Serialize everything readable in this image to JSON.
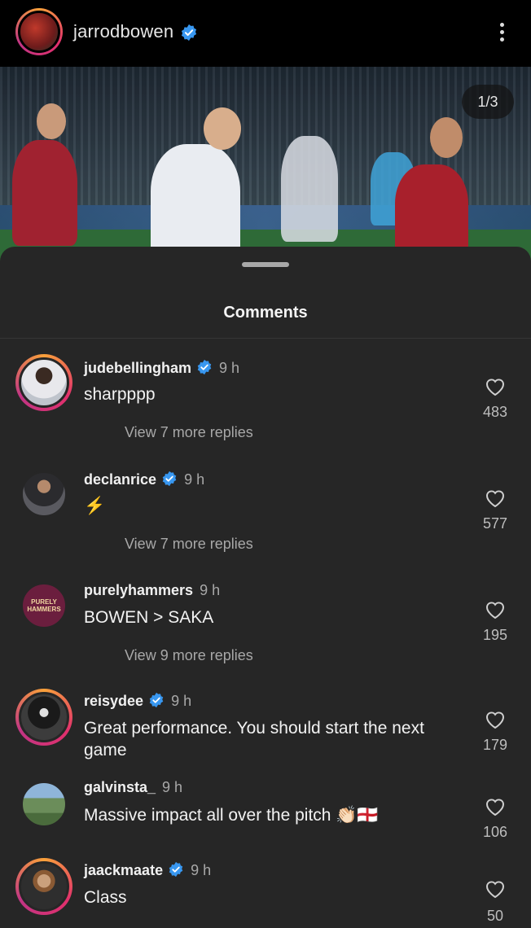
{
  "header": {
    "username": "jarrodbowen",
    "more_icon": "more-vertical-icon"
  },
  "post": {
    "image_counter": "1/3"
  },
  "sheet": {
    "title": "Comments"
  },
  "colors": {
    "verified": "#3897f0",
    "background": "#262626",
    "muted": "#a8a8a8"
  },
  "comments": [
    {
      "username": "judebellingham",
      "verified": true,
      "time": "9 h",
      "text": "sharpppp",
      "replies": "View 7 more replies",
      "likes": "483"
    },
    {
      "username": "declanrice",
      "verified": true,
      "time": "9 h",
      "text": "⚡",
      "replies": "View 7 more replies",
      "likes": "577"
    },
    {
      "username": "purelyhammers",
      "verified": false,
      "time": "9 h",
      "text": "BOWEN > SAKA",
      "replies": "View 9 more replies",
      "likes": "195",
      "avatar_text": "PURELY HAMMERS"
    },
    {
      "username": "reisydee",
      "verified": true,
      "time": "9 h",
      "text": "Great performance. You should start the next game",
      "likes": "179"
    },
    {
      "username": "galvinsta_",
      "verified": false,
      "time": "9 h",
      "text": "Massive impact all over the pitch 👏🏻🏴󠁧󠁢󠁥󠁮󠁧󠁿",
      "likes": "106"
    },
    {
      "username": "jaackmaate",
      "verified": true,
      "time": "9 h",
      "text": "Class",
      "likes": "50"
    }
  ]
}
